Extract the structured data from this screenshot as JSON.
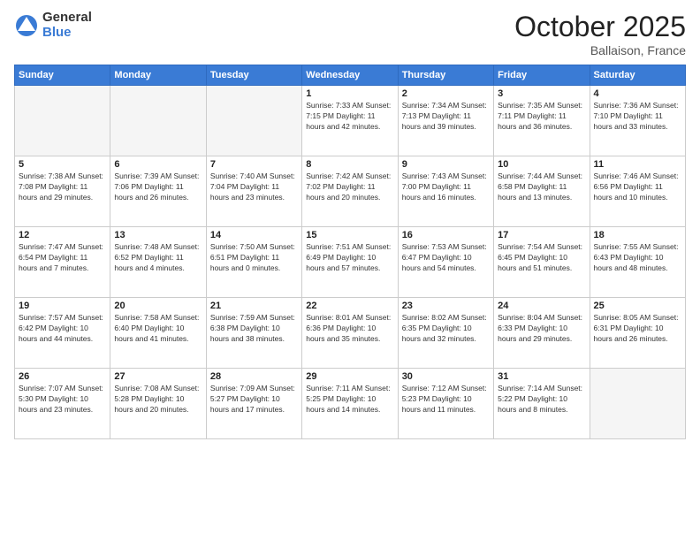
{
  "logo": {
    "general": "General",
    "blue": "Blue"
  },
  "header": {
    "month": "October 2025",
    "location": "Ballaison, France"
  },
  "weekdays": [
    "Sunday",
    "Monday",
    "Tuesday",
    "Wednesday",
    "Thursday",
    "Friday",
    "Saturday"
  ],
  "weeks": [
    [
      {
        "day": "",
        "info": ""
      },
      {
        "day": "",
        "info": ""
      },
      {
        "day": "",
        "info": ""
      },
      {
        "day": "1",
        "info": "Sunrise: 7:33 AM\nSunset: 7:15 PM\nDaylight: 11 hours\nand 42 minutes."
      },
      {
        "day": "2",
        "info": "Sunrise: 7:34 AM\nSunset: 7:13 PM\nDaylight: 11 hours\nand 39 minutes."
      },
      {
        "day": "3",
        "info": "Sunrise: 7:35 AM\nSunset: 7:11 PM\nDaylight: 11 hours\nand 36 minutes."
      },
      {
        "day": "4",
        "info": "Sunrise: 7:36 AM\nSunset: 7:10 PM\nDaylight: 11 hours\nand 33 minutes."
      }
    ],
    [
      {
        "day": "5",
        "info": "Sunrise: 7:38 AM\nSunset: 7:08 PM\nDaylight: 11 hours\nand 29 minutes."
      },
      {
        "day": "6",
        "info": "Sunrise: 7:39 AM\nSunset: 7:06 PM\nDaylight: 11 hours\nand 26 minutes."
      },
      {
        "day": "7",
        "info": "Sunrise: 7:40 AM\nSunset: 7:04 PM\nDaylight: 11 hours\nand 23 minutes."
      },
      {
        "day": "8",
        "info": "Sunrise: 7:42 AM\nSunset: 7:02 PM\nDaylight: 11 hours\nand 20 minutes."
      },
      {
        "day": "9",
        "info": "Sunrise: 7:43 AM\nSunset: 7:00 PM\nDaylight: 11 hours\nand 16 minutes."
      },
      {
        "day": "10",
        "info": "Sunrise: 7:44 AM\nSunset: 6:58 PM\nDaylight: 11 hours\nand 13 minutes."
      },
      {
        "day": "11",
        "info": "Sunrise: 7:46 AM\nSunset: 6:56 PM\nDaylight: 11 hours\nand 10 minutes."
      }
    ],
    [
      {
        "day": "12",
        "info": "Sunrise: 7:47 AM\nSunset: 6:54 PM\nDaylight: 11 hours\nand 7 minutes."
      },
      {
        "day": "13",
        "info": "Sunrise: 7:48 AM\nSunset: 6:52 PM\nDaylight: 11 hours\nand 4 minutes."
      },
      {
        "day": "14",
        "info": "Sunrise: 7:50 AM\nSunset: 6:51 PM\nDaylight: 11 hours\nand 0 minutes."
      },
      {
        "day": "15",
        "info": "Sunrise: 7:51 AM\nSunset: 6:49 PM\nDaylight: 10 hours\nand 57 minutes."
      },
      {
        "day": "16",
        "info": "Sunrise: 7:53 AM\nSunset: 6:47 PM\nDaylight: 10 hours\nand 54 minutes."
      },
      {
        "day": "17",
        "info": "Sunrise: 7:54 AM\nSunset: 6:45 PM\nDaylight: 10 hours\nand 51 minutes."
      },
      {
        "day": "18",
        "info": "Sunrise: 7:55 AM\nSunset: 6:43 PM\nDaylight: 10 hours\nand 48 minutes."
      }
    ],
    [
      {
        "day": "19",
        "info": "Sunrise: 7:57 AM\nSunset: 6:42 PM\nDaylight: 10 hours\nand 44 minutes."
      },
      {
        "day": "20",
        "info": "Sunrise: 7:58 AM\nSunset: 6:40 PM\nDaylight: 10 hours\nand 41 minutes."
      },
      {
        "day": "21",
        "info": "Sunrise: 7:59 AM\nSunset: 6:38 PM\nDaylight: 10 hours\nand 38 minutes."
      },
      {
        "day": "22",
        "info": "Sunrise: 8:01 AM\nSunset: 6:36 PM\nDaylight: 10 hours\nand 35 minutes."
      },
      {
        "day": "23",
        "info": "Sunrise: 8:02 AM\nSunset: 6:35 PM\nDaylight: 10 hours\nand 32 minutes."
      },
      {
        "day": "24",
        "info": "Sunrise: 8:04 AM\nSunset: 6:33 PM\nDaylight: 10 hours\nand 29 minutes."
      },
      {
        "day": "25",
        "info": "Sunrise: 8:05 AM\nSunset: 6:31 PM\nDaylight: 10 hours\nand 26 minutes."
      }
    ],
    [
      {
        "day": "26",
        "info": "Sunrise: 7:07 AM\nSunset: 5:30 PM\nDaylight: 10 hours\nand 23 minutes."
      },
      {
        "day": "27",
        "info": "Sunrise: 7:08 AM\nSunset: 5:28 PM\nDaylight: 10 hours\nand 20 minutes."
      },
      {
        "day": "28",
        "info": "Sunrise: 7:09 AM\nSunset: 5:27 PM\nDaylight: 10 hours\nand 17 minutes."
      },
      {
        "day": "29",
        "info": "Sunrise: 7:11 AM\nSunset: 5:25 PM\nDaylight: 10 hours\nand 14 minutes."
      },
      {
        "day": "30",
        "info": "Sunrise: 7:12 AM\nSunset: 5:23 PM\nDaylight: 10 hours\nand 11 minutes."
      },
      {
        "day": "31",
        "info": "Sunrise: 7:14 AM\nSunset: 5:22 PM\nDaylight: 10 hours\nand 8 minutes."
      },
      {
        "day": "",
        "info": ""
      }
    ]
  ]
}
